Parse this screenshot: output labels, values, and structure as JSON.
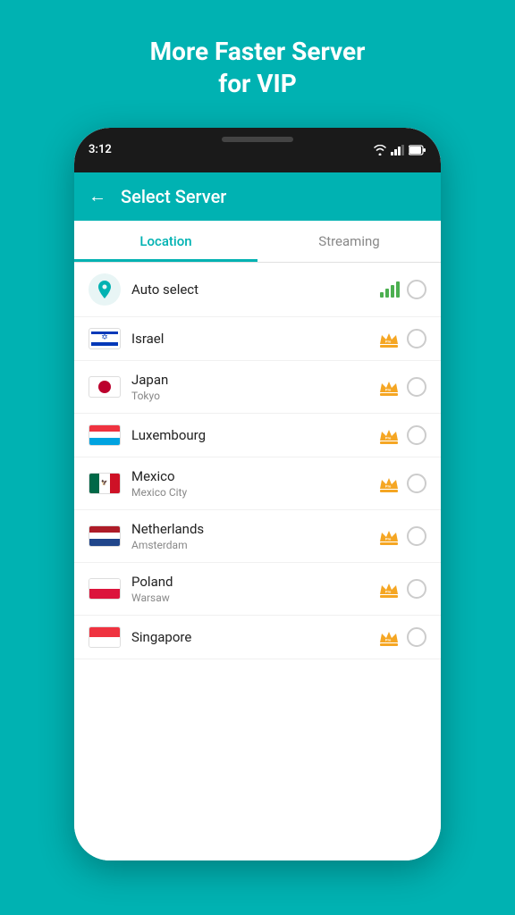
{
  "header": {
    "title_line1": "More Faster Server",
    "title_line2": "for VIP"
  },
  "status_bar": {
    "time": "3:12"
  },
  "app_bar": {
    "title": "Select Server",
    "back_label": "←"
  },
  "tabs": [
    {
      "id": "location",
      "label": "Location",
      "active": true
    },
    {
      "id": "streaming",
      "label": "Streaming",
      "active": false
    }
  ],
  "servers": [
    {
      "id": "auto",
      "name": "Auto select",
      "city": "",
      "type": "auto",
      "has_signal": true,
      "is_pro": false
    },
    {
      "id": "israel",
      "name": "Israel",
      "city": "",
      "type": "israel",
      "has_signal": false,
      "is_pro": true
    },
    {
      "id": "japan",
      "name": "Japan",
      "city": "Tokyo",
      "type": "japan",
      "has_signal": false,
      "is_pro": true
    },
    {
      "id": "luxembourg",
      "name": "Luxembourg",
      "city": "",
      "type": "luxembourg",
      "has_signal": false,
      "is_pro": true
    },
    {
      "id": "mexico",
      "name": "Mexico",
      "city": "Mexico City",
      "type": "mexico",
      "has_signal": false,
      "is_pro": true
    },
    {
      "id": "netherlands",
      "name": "Netherlands",
      "city": "Amsterdam",
      "type": "netherlands",
      "has_signal": false,
      "is_pro": true
    },
    {
      "id": "poland",
      "name": "Poland",
      "city": "Warsaw",
      "type": "poland",
      "has_signal": false,
      "is_pro": true
    },
    {
      "id": "singapore",
      "name": "Singapore",
      "city": "",
      "type": "singapore",
      "has_signal": false,
      "is_pro": true
    }
  ]
}
